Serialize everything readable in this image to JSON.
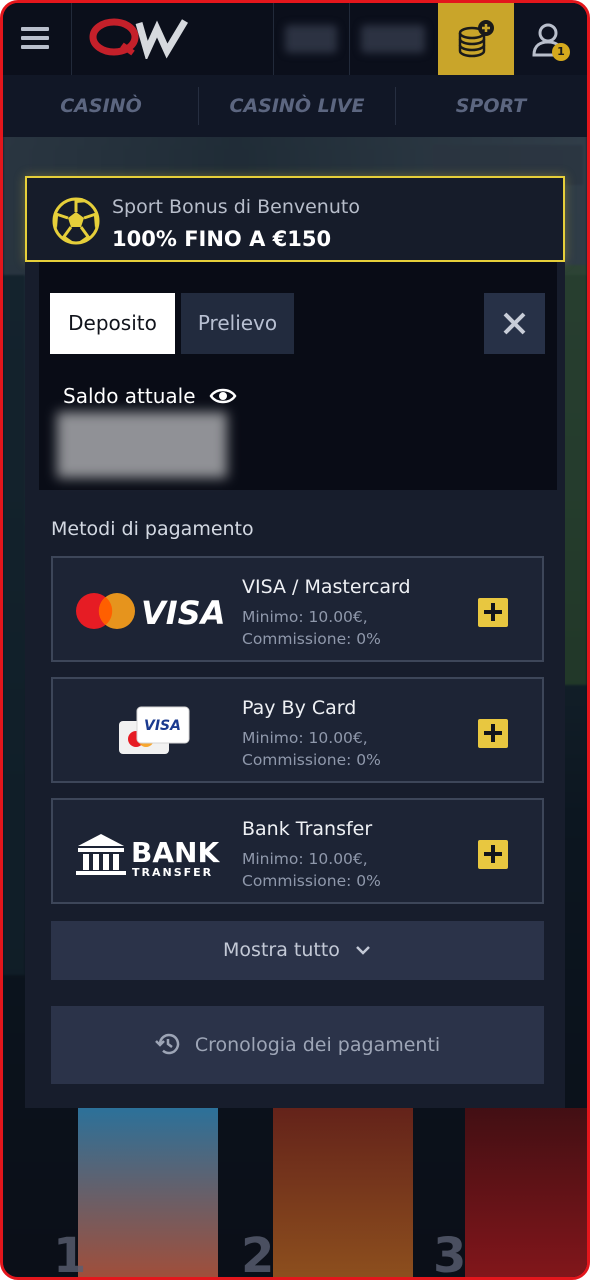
{
  "header": {
    "logo_text": "QW",
    "notification_count": "1",
    "icons": [
      "menu-icon",
      "logo",
      "coins-add-icon",
      "user-icon"
    ]
  },
  "nav": {
    "items": [
      {
        "label": "CASINÒ"
      },
      {
        "label": "CASINÒ LIVE"
      },
      {
        "label": "SPORT"
      }
    ]
  },
  "bonus": {
    "subtitle": "Sport Bonus di Benvenuto",
    "title": "100% FINO A €150",
    "icon": "soccer-ball-icon",
    "accent_color": "#e6cf3a"
  },
  "wallet": {
    "tabs": [
      {
        "label": "Deposito",
        "active": true
      },
      {
        "label": "Prelievo",
        "active": false
      }
    ],
    "balance_label": "Saldo attuale",
    "balance_value_hidden": true
  },
  "payment": {
    "section_label": "Metodi di pagamento",
    "methods": [
      {
        "name": "VISA / Mastercard",
        "min": "Minimo: 10.00€,",
        "fee": "Commissione: 0%",
        "logo": "visa-mastercard-logo"
      },
      {
        "name": "Pay By Card",
        "min": "Minimo: 10.00€,",
        "fee": "Commissione: 0%",
        "logo": "pay-by-card-logo"
      },
      {
        "name": "Bank Transfer",
        "min": "Minimo: 10.00€,",
        "fee": "Commissione: 0%",
        "logo": "bank-transfer-logo"
      }
    ],
    "show_all": "Mostra tutto",
    "history": "Cronologia dei pagamenti"
  },
  "logos": {
    "visa": "VISA",
    "bank": "BANK",
    "transfer": "TRANSFER"
  },
  "colors": {
    "brand_red": "#e3161c",
    "gold": "#e8c740",
    "panel_bg": "#171d2c"
  }
}
